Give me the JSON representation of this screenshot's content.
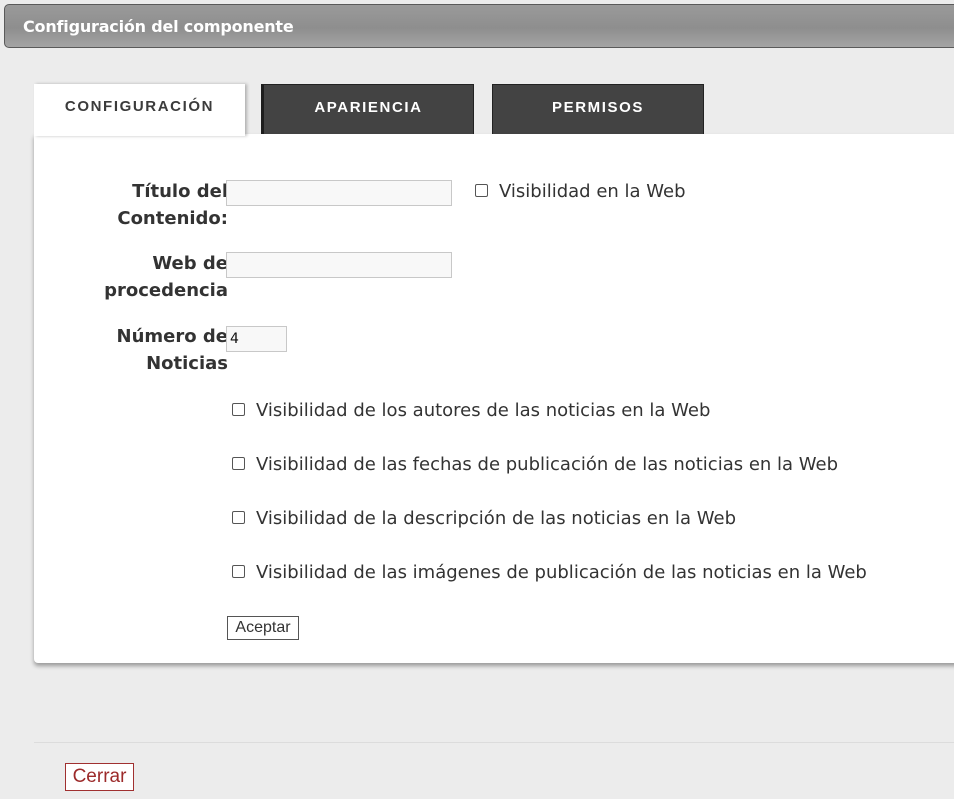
{
  "window": {
    "title": "Configuración del componente"
  },
  "tabs": [
    {
      "label": "CONFIGURACIÓN",
      "active": true
    },
    {
      "label": "APARIENCIA",
      "active": false
    },
    {
      "label": "PERMISOS",
      "active": false
    }
  ],
  "form": {
    "titulo": {
      "label_line1": "Título del",
      "label_line2": "Contenido:",
      "value": ""
    },
    "visibilidad_web_label": "Visibilidad en la Web",
    "web_procedencia": {
      "label_line1": "Web de",
      "label_line2": "procedencia",
      "value": ""
    },
    "numero_noticias": {
      "label_line1": "Número de",
      "label_line2": "Noticias",
      "value": "4"
    },
    "options": [
      {
        "label": "Visibilidad de los autores de las noticias en la Web",
        "checked": false
      },
      {
        "label": "Visibilidad de las fechas de publicación de las noticias en la Web",
        "checked": false
      },
      {
        "label": "Visibilidad de la descripción de las noticias en la Web",
        "checked": false
      },
      {
        "label": "Visibilidad de las imágenes de publicación de las noticias en la Web",
        "checked": false
      }
    ],
    "submit_label": "Aceptar"
  },
  "footer": {
    "close_label": "Cerrar"
  },
  "colors": {
    "header_bg": "#959595",
    "tab_dark_bg": "#434343",
    "close_accent": "#9c2a2a"
  }
}
